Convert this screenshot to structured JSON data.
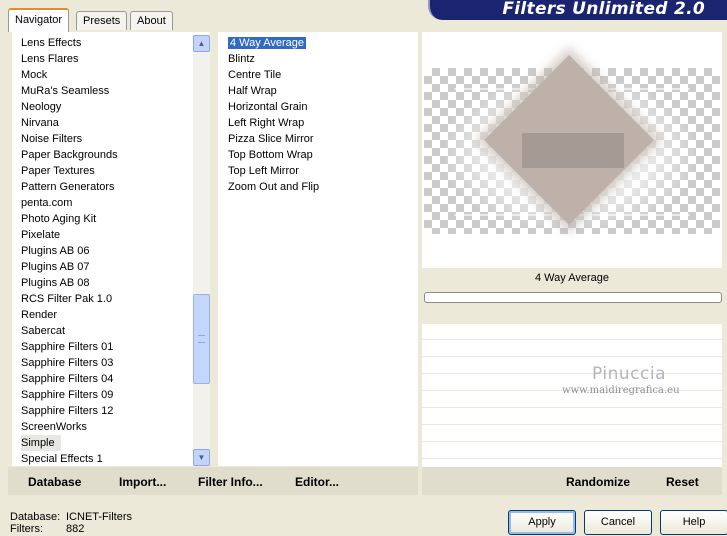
{
  "app": {
    "title": "Filters Unlimited 2.0"
  },
  "tabs": [
    {
      "label": "Navigator",
      "active": true
    },
    {
      "label": "Presets",
      "active": false
    },
    {
      "label": "About",
      "active": false
    }
  ],
  "categories": {
    "items": [
      "Lens Effects",
      "Lens Flares",
      "Mock",
      "MuRa's Seamless",
      "Neology",
      "Nirvana",
      "Noise Filters",
      "Paper Backgrounds",
      "Paper Textures",
      "Pattern Generators",
      "penta.com",
      "Photo Aging Kit",
      "Pixelate",
      "Plugins AB 06",
      "Plugins AB 07",
      "Plugins AB 08",
      "RCS Filter Pak 1.0",
      "Render",
      "Sabercat",
      "Sapphire Filters 01",
      "Sapphire Filters 03",
      "Sapphire Filters 04",
      "Sapphire Filters 09",
      "Sapphire Filters 12",
      "ScreenWorks",
      "Simple",
      "Special Effects 1"
    ],
    "selected": "Simple"
  },
  "filters": {
    "items": [
      "4 Way Average",
      "Blintz",
      "Centre Tile",
      "Half Wrap",
      "Horizontal Grain",
      "Left Right Wrap",
      "Pizza Slice Mirror",
      "Top Bottom Wrap",
      "Top Left Mirror",
      "Zoom Out and Flip"
    ],
    "selected": "4 Way Average"
  },
  "nav_buttons": {
    "database": "Database",
    "import": "Import...",
    "filter_info": "Filter Info...",
    "editor": "Editor..."
  },
  "preview": {
    "filter_name": "4 Way Average",
    "progress": 0
  },
  "watermark": {
    "name": "Pinuccia",
    "site": "www.maidiregrafica.eu"
  },
  "right_buttons": {
    "randomize": "Randomize",
    "reset": "Reset"
  },
  "footer": {
    "database_label": "Database:",
    "database_value": "ICNET-Filters",
    "filters_label": "Filters:",
    "filters_value": "882"
  },
  "dialog_buttons": {
    "apply": "Apply",
    "cancel": "Cancel",
    "help": "Help"
  },
  "colors": {
    "selection": "#316ac5",
    "banner": "#1a2470",
    "panel_bg": "#ece9d8"
  },
  "icons": {
    "scroll_up": "chevron-up-icon",
    "scroll_down": "chevron-down-icon"
  }
}
